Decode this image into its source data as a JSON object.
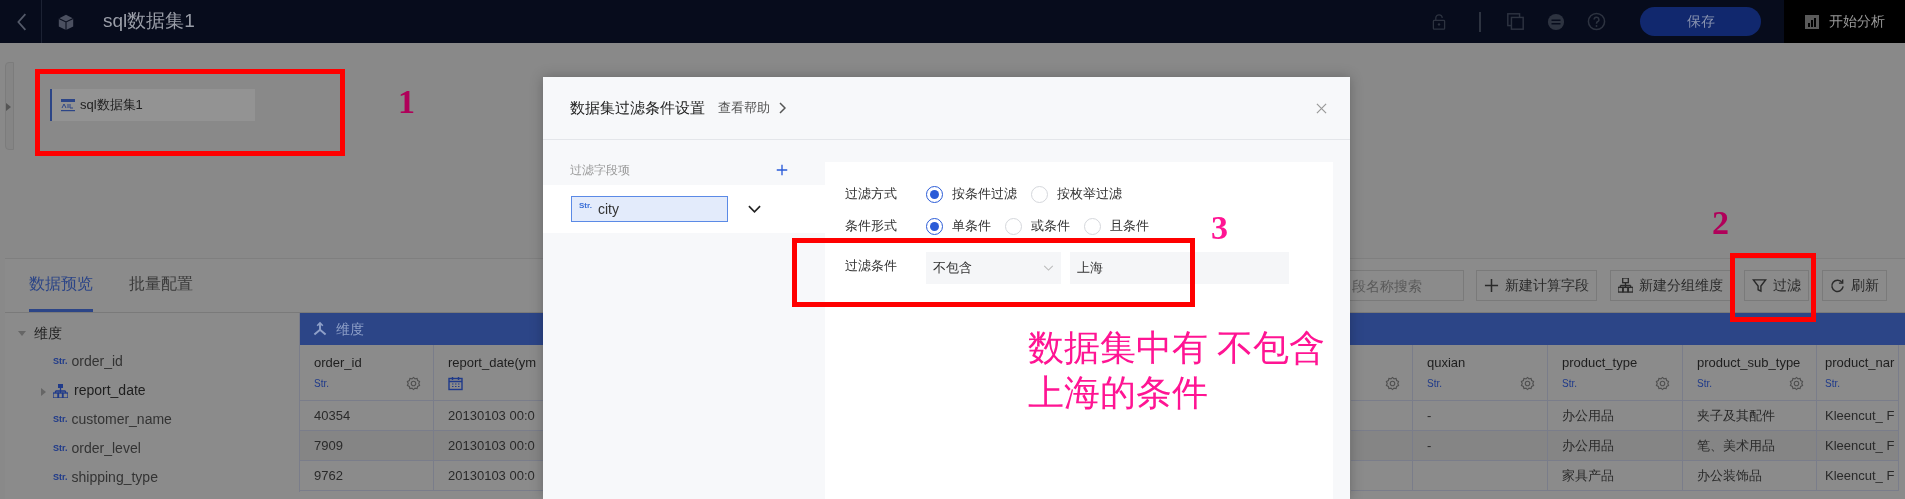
{
  "header": {
    "title": "sql数据集1",
    "save_button": "保存",
    "analyze_button": "开始分析"
  },
  "dataset_list": [
    {
      "label": "sql数据集1",
      "selected": true
    }
  ],
  "tabs": [
    {
      "label": "数据预览",
      "selected": true
    },
    {
      "label": "批量配置",
      "selected": false
    }
  ],
  "toolbar": {
    "search": {
      "placeholder": "段名称搜索"
    },
    "buttons": [
      {
        "label": "新建计算字段",
        "kind": "plus"
      },
      {
        "label": "新建分组维度",
        "kind": "hierarchy"
      },
      {
        "label": "过滤",
        "kind": "filter"
      },
      {
        "label": "刷新",
        "kind": "refresh"
      }
    ]
  },
  "field_tree": {
    "group": {
      "label": "维度",
      "expanded": true
    },
    "items": [
      {
        "label": "order_id",
        "kind": "string",
        "badge": "Str."
      },
      {
        "label": "report_date",
        "kind": "hierarchy"
      },
      {
        "label": "customer_name",
        "kind": "string",
        "badge": "Str."
      },
      {
        "label": "order_level",
        "kind": "string",
        "badge": "Str."
      },
      {
        "label": "shipping_type",
        "kind": "string",
        "badge": "Str."
      }
    ]
  },
  "table": {
    "group_label": "维度",
    "left_columns": [
      {
        "name": "order_id",
        "kind": "string",
        "type_label": "Str.",
        "settings": true
      },
      {
        "name": "report_date(ym",
        "kind": "date",
        "settings": false
      }
    ],
    "left_rows": [
      [
        "40354",
        "20130103 00:0"
      ],
      [
        "7909",
        "20130103 00:0"
      ],
      [
        "9762",
        "20130103 00:0"
      ]
    ],
    "right_columns": [
      {
        "kind": "hidden",
        "settings": true
      },
      {
        "name": "quxian",
        "kind": "string",
        "type_label": "Str.",
        "settings": true
      },
      {
        "name": "product_type",
        "kind": "string",
        "type_label": "Str.",
        "settings": true
      },
      {
        "name": "product_sub_type",
        "kind": "string",
        "type_label": "Str.",
        "settings": true
      },
      {
        "name": "product_nar",
        "kind": "string",
        "type_label": "Str.",
        "settings": false
      }
    ],
    "right_rows": [
      [
        null,
        "-",
        "办公用品",
        "夹子及其配件",
        "Kleencut_ F"
      ],
      [
        null,
        "-",
        "办公用品",
        "笔、美术用品",
        "Kleencut_ F"
      ],
      [
        null,
        null,
        "家具产品",
        "办公装饰品",
        "Kleencut_ F"
      ]
    ]
  },
  "filter_dialog": {
    "title": "数据集过滤条件设置",
    "help_link": "查看帮助",
    "field_list_label": "过滤字段项",
    "fields": [
      {
        "label": "city",
        "badge": "Str.",
        "selected": true
      }
    ],
    "settings": [
      {
        "label": "过滤方式",
        "kind": "radio",
        "options": [
          {
            "label": "按条件过滤",
            "selected": true
          },
          {
            "label": "按枚举过滤",
            "selected": false
          }
        ]
      },
      {
        "label": "条件形式",
        "kind": "radio",
        "options": [
          {
            "label": "单条件",
            "selected": true
          },
          {
            "label": "或条件",
            "selected": false
          },
          {
            "label": "且条件",
            "selected": false
          }
        ]
      },
      {
        "label": "过滤条件",
        "kind": "condition",
        "operator": "不包含",
        "value": "上海"
      }
    ]
  },
  "annotations": [
    {
      "label": "1"
    },
    {
      "label": "2"
    },
    {
      "label": "3"
    },
    {
      "lines": [
        "数据集中有 不包含",
        "上海的条件"
      ]
    }
  ]
}
